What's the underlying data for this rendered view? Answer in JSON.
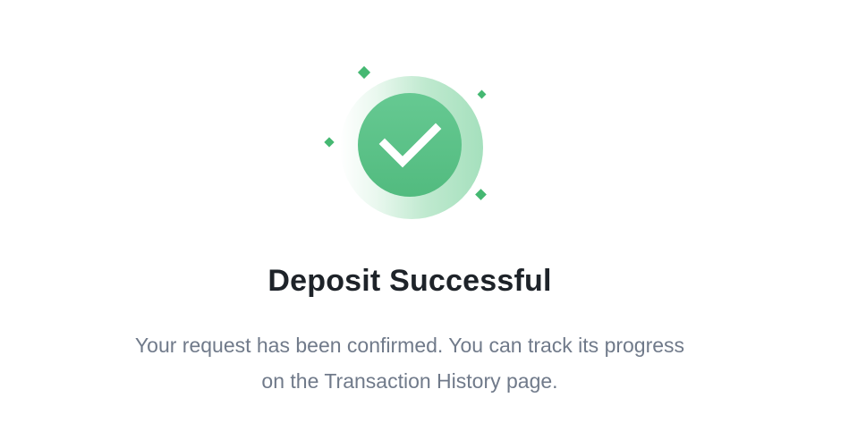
{
  "status": {
    "icon": "check-circle-icon",
    "accent_color": "#52BB7F",
    "sparkle_icon": "sparkle-icon"
  },
  "title": "Deposit Successful",
  "message": {
    "line1": "Your request has been confirmed. You can track its progress",
    "line2": "on the Transaction History page."
  }
}
